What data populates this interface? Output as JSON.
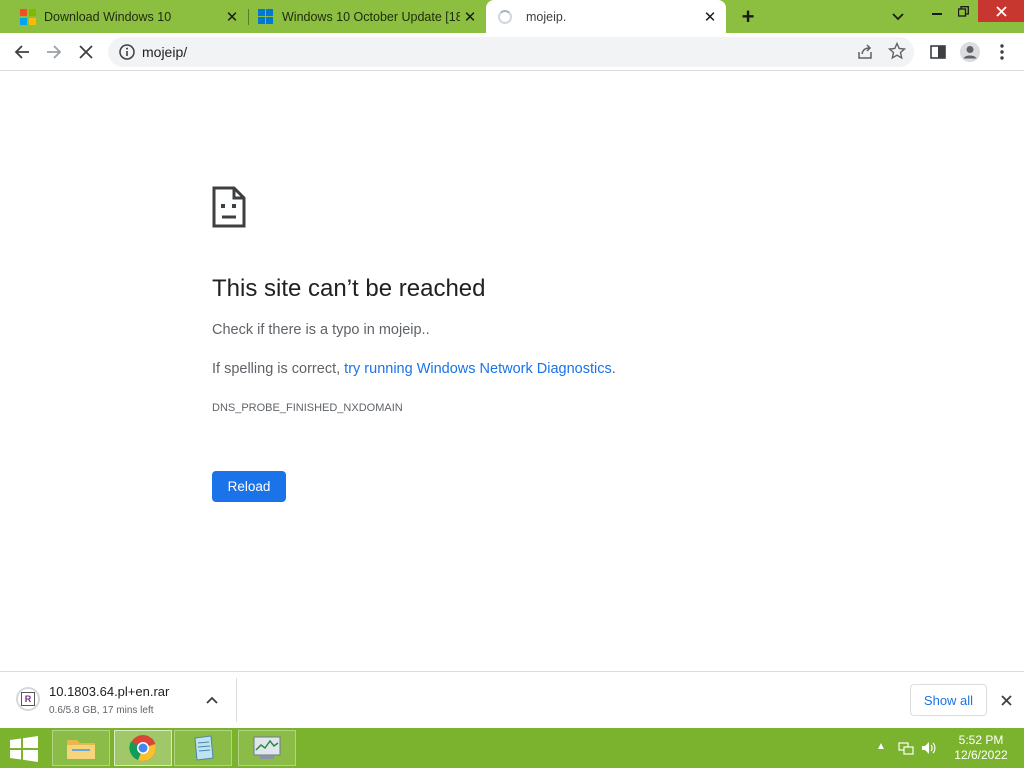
{
  "tabs": [
    {
      "title": "Download Windows 10",
      "icon": "microsoft-logo-icon"
    },
    {
      "title": "Windows 10 October Update [18",
      "icon": "windows-logo-icon"
    },
    {
      "title": "mojeip.",
      "icon": "loading-spinner-icon",
      "active": true
    }
  ],
  "omnibox": {
    "url": "mojeip/"
  },
  "error": {
    "title": "This site can’t be reached",
    "line1": "Check if there is a typo in mojeip..",
    "line2_prefix": "If spelling is correct, ",
    "line2_link": "try running Windows Network Diagnostics",
    "line2_suffix": ".",
    "code": "DNS_PROBE_FINISHED_NXDOMAIN",
    "reload_label": "Reload"
  },
  "download": {
    "filename": "10.1803.64.pl+en.rar",
    "status": "0.6/5.8 GB, 17 mins left",
    "show_all_label": "Show all"
  },
  "taskbar": {
    "apps": [
      "file-explorer",
      "chrome",
      "notepad",
      "task-manager"
    ],
    "active_app": "chrome"
  },
  "clock": {
    "time": "5:52 PM",
    "date": "12/6/2022"
  },
  "colors": {
    "tabstrip": "#8cbf3f",
    "taskbar": "#7cb32e",
    "accent": "#1a73e8",
    "close_button": "#c7372f"
  }
}
